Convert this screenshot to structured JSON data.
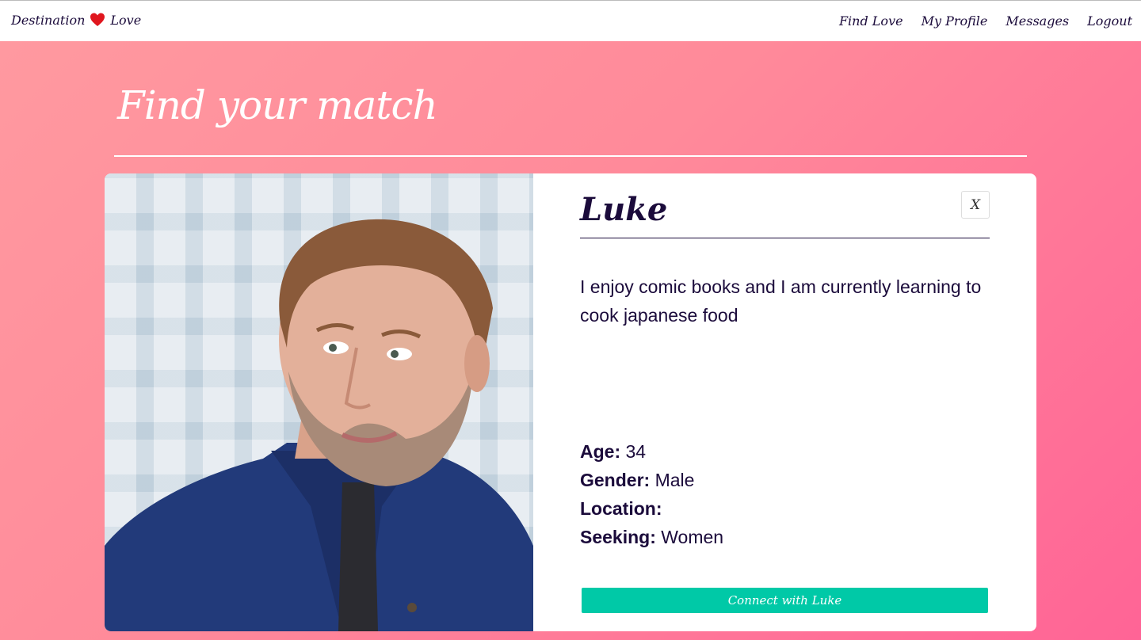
{
  "navbar": {
    "brand_left": "Destination",
    "brand_icon": "heart-icon",
    "brand_right": "Love",
    "links": [
      "Find Love",
      "My Profile",
      "Messages",
      "Logout"
    ]
  },
  "main": {
    "title": "Find your match"
  },
  "profile": {
    "name": "Luke",
    "close_label": "X",
    "bio": "I enjoy comic books and I am currently learning to cook japanese food",
    "details": [
      {
        "label": "Age:",
        "value": "34"
      },
      {
        "label": "Gender:",
        "value": "Male"
      },
      {
        "label": "Location:",
        "value": ""
      },
      {
        "label": "Seeking:",
        "value": "Women"
      }
    ],
    "connect_label": "Connect with Luke"
  },
  "colors": {
    "accent": "#00c9a7",
    "heading": "#1b0b3b",
    "gradient_start": "#ff9aa0",
    "gradient_end": "#ff6496"
  }
}
